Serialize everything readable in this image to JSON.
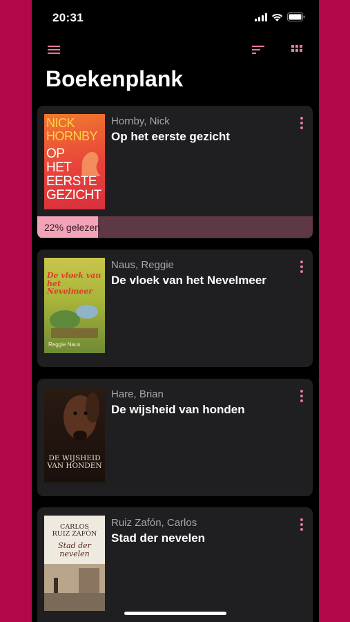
{
  "status_bar": {
    "time": "20:31"
  },
  "header": {
    "title": "Boekenplank",
    "menu_icon": "hamburger-menu-icon",
    "sort_icon": "sort-icon",
    "grid_icon": "grid-view-icon"
  },
  "colors": {
    "frame": "#b3084a",
    "accent": "#e7799a",
    "card": "#1f1f21",
    "progress_track": "#5e3845",
    "progress_fill": "#f3a3b8"
  },
  "books": [
    {
      "author": "Hornby, Nick",
      "title": "Op het eerste gezicht",
      "progress_label": "22% gelezen",
      "progress": 0.22,
      "cover": {
        "line1": "NICK\nHORNBY",
        "line2": "OP\nHET\nEERSTE\nGEZICHT"
      }
    },
    {
      "author": "Naus, Reggie",
      "title": "De vloek van het Nevelmeer",
      "cover": {
        "line1": "De vloek van\nhet Nevelmeer",
        "line2": "Reggie Naus"
      }
    },
    {
      "author": "Hare, Brian",
      "title": "De wijsheid van honden",
      "cover": {
        "line1": "DE WIJSHEID\nVAN HONDEN"
      }
    },
    {
      "author": "Ruiz Zafón, Carlos",
      "title": "Stad der nevelen",
      "cover": {
        "line1": "CARLOS\nRUIZ ZAFÓN",
        "line2": "Stad der\nnevelen"
      }
    }
  ]
}
